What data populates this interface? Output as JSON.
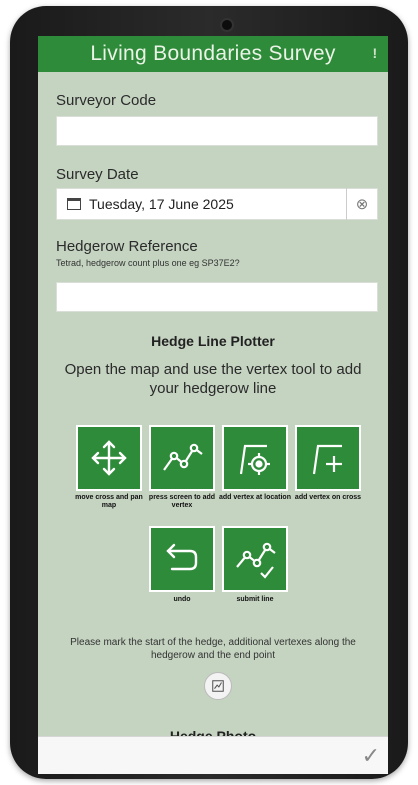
{
  "header": {
    "title": "Living Boundaries Survey",
    "info_icon": "info-icon"
  },
  "surveyor": {
    "label": "Surveyor Code",
    "value": ""
  },
  "survey_date": {
    "label": "Survey Date",
    "value": "Tuesday, 17 June 2025"
  },
  "hedgerow": {
    "label": "Hedgerow Reference",
    "hint": "Tetrad, hedgerow count plus one eg SP37E2?",
    "value": ""
  },
  "plotter": {
    "title": "Hedge Line Plotter",
    "description": "Open the map and use the vertex tool to add your hedgerow line",
    "tools": [
      {
        "icon": "move-cross-icon",
        "caption": "move cross and pan map"
      },
      {
        "icon": "polyline-icon",
        "caption": "press screen to add vertex"
      },
      {
        "icon": "vertex-location-icon",
        "caption": "add vertex at location"
      },
      {
        "icon": "vertex-cross-icon",
        "caption": "add vertex on cross"
      },
      {
        "icon": "undo-icon",
        "caption": "undo"
      },
      {
        "icon": "submit-line-icon",
        "caption": "submit line"
      }
    ],
    "note": "Please mark the start of the hedge, additional vertexes along the hedgerow and the end point"
  },
  "next_section": {
    "title": "Hedge Photo"
  },
  "footer": {
    "submit_icon": "checkmark-icon"
  },
  "colors": {
    "header": "#2e8b3a",
    "background": "#c5d3c1",
    "tool": "#2e8b3a"
  }
}
